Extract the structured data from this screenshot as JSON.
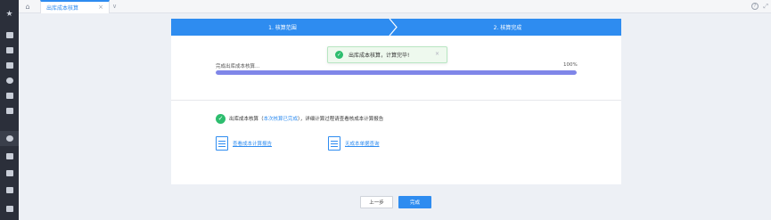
{
  "sidebar": {
    "items": [
      {
        "icon": "star-icon"
      },
      {
        "icon": "calendar-icon"
      },
      {
        "icon": "inbox-icon"
      },
      {
        "icon": "gem-icon"
      },
      {
        "icon": "coin-icon"
      },
      {
        "icon": "bar-chart-icon"
      },
      {
        "icon": "cart-icon"
      },
      {
        "icon": "cost-icon"
      },
      {
        "icon": "report-icon"
      },
      {
        "icon": "box-icon"
      },
      {
        "icon": "archive-icon"
      },
      {
        "icon": "folder-icon"
      }
    ]
  },
  "topbar": {
    "tab_label": "出库成本核算",
    "tab_close": "×",
    "more_glyph": "∨",
    "help_glyph": "?",
    "expand_glyph": "⤢"
  },
  "steps": {
    "step1": "1. 核算范围",
    "step2": "2. 核算完成"
  },
  "progress": {
    "label": "完成出库成本核算...",
    "percent_text": "100%",
    "value": 1.0
  },
  "toast": {
    "text": "出库成本核算，计算完毕!",
    "close": "×"
  },
  "result": {
    "prefix": "出库成本核算（",
    "highlight": "本次核算已完成",
    "suffix": "），详细计算过程请查看核成本计算报告"
  },
  "links": {
    "report": "查看成本计算报告",
    "no_cost_query": "无成本单据查询"
  },
  "buttons": {
    "prev": "上一步",
    "done": "完成"
  },
  "colors": {
    "accent": "#2e8cf0",
    "success": "#2dbd6e",
    "progress": "#7f86e8",
    "sidebar": "#2b2f3a"
  }
}
